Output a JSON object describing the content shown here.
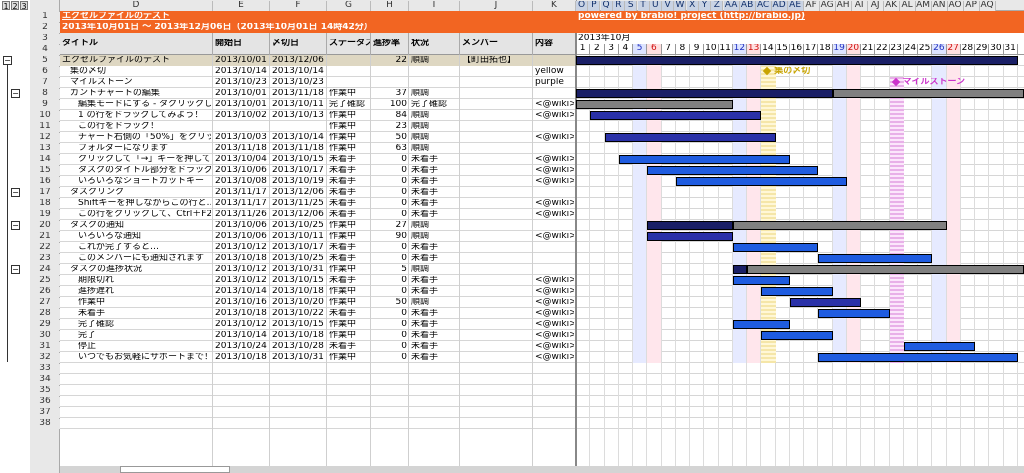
{
  "outline_levels": [
    "1",
    "2",
    "3"
  ],
  "columns": [
    "D",
    "E",
    "F",
    "G",
    "H",
    "I",
    "J",
    "K",
    "O",
    "P",
    "Q",
    "R",
    "S",
    "T",
    "U",
    "V",
    "W",
    "X",
    "Y",
    "Z",
    "AA",
    "AB",
    "AC",
    "AD",
    "AE",
    "AF",
    "AG",
    "AH",
    "AI",
    "AJ",
    "AK",
    "AL",
    "AM",
    "AN",
    "AO",
    "AP",
    "AQ"
  ],
  "header": {
    "title": "エクセルファイルのテスト",
    "date_range": "2013年10月01日 〜 2013年12月06日（2013年10月01日 14時42分）",
    "powered_by": "powered by brabio! project (http://brabio.jp)",
    "month": "2013年10月"
  },
  "table_headers": [
    "タイトル",
    "開始日",
    "〆切日",
    "ステータス",
    "進捗率",
    "状況",
    "メンバー",
    "内容"
  ],
  "days": [
    "1",
    "2",
    "3",
    "4",
    "5",
    "6",
    "7",
    "8",
    "9",
    "10",
    "11",
    "12",
    "13",
    "14",
    "15",
    "16",
    "17",
    "18",
    "19",
    "20",
    "21",
    "22",
    "23",
    "24",
    "25",
    "26",
    "27",
    "28",
    "29",
    "30",
    "31"
  ],
  "rows": [
    {
      "num": "5",
      "title": "エクセルファイルのテスト",
      "start": "2013/10/01",
      "end": "2013/12/06",
      "status": "",
      "pct": "22",
      "state": "順調",
      "member": "【町田拓也】",
      "content": ""
    },
    {
      "num": "6",
      "title": "集の〆切",
      "start": "2013/10/14",
      "end": "2013/10/14",
      "status": "",
      "pct": "",
      "state": "",
      "member": "",
      "content": "yellow"
    },
    {
      "num": "7",
      "title": "マイルストーン",
      "start": "2013/10/23",
      "end": "2013/10/23",
      "status": "",
      "pct": "",
      "state": "",
      "member": "",
      "content": "purple"
    },
    {
      "num": "8",
      "title": "ガントチャートの編集",
      "start": "2013/10/01",
      "end": "2013/11/18",
      "status": "作業中",
      "pct": "37",
      "state": "順調",
      "member": "",
      "content": ""
    },
    {
      "num": "9",
      "title": "編集モードにする - タクリックして",
      "start": "2013/10/01",
      "end": "2013/10/11",
      "status": "完了確認",
      "pct": "100",
      "state": "完了確認",
      "member": "",
      "content": "<@wiki>"
    },
    {
      "num": "10",
      "title": "1 の行をドラッグしてみよう！",
      "start": "2013/10/02",
      "end": "2013/10/13",
      "status": "作業中",
      "pct": "84",
      "state": "順調",
      "member": "",
      "content": "<@wiki>"
    },
    {
      "num": "11",
      "title": "この行をドラッグ！",
      "start": "",
      "end": "",
      "status": "作業中",
      "pct": "23",
      "state": "順調",
      "member": "",
      "content": ""
    },
    {
      "num": "12",
      "title": "チャート右側の「50%」をクリックし",
      "start": "2013/10/03",
      "end": "2013/10/14",
      "status": "作業中",
      "pct": "50",
      "state": "順調",
      "member": "",
      "content": "<@wiki>"
    },
    {
      "num": "13",
      "title": "フォルダーになります",
      "start": "2013/11/18",
      "end": "2013/11/18",
      "status": "作業中",
      "pct": "63",
      "state": "順調",
      "member": "",
      "content": ""
    },
    {
      "num": "14",
      "title": "クリックして「→」キーを押してみよ",
      "start": "2013/10/04",
      "end": "2013/10/15",
      "status": "未着手",
      "pct": "0",
      "state": "未着手",
      "member": "",
      "content": "<@wiki>"
    },
    {
      "num": "15",
      "title": "タスクのタイトル部分をドラッグす",
      "start": "2013/10/06",
      "end": "2013/10/17",
      "status": "未着手",
      "pct": "0",
      "state": "未着手",
      "member": "",
      "content": "<@wiki>"
    },
    {
      "num": "16",
      "title": "いろいろなショートカットキー",
      "start": "2013/10/08",
      "end": "2013/10/19",
      "status": "未着手",
      "pct": "0",
      "state": "未着手",
      "member": "",
      "content": "<@wiki>"
    },
    {
      "num": "17",
      "title": "タスクリンク",
      "start": "2013/11/17",
      "end": "2013/12/06",
      "status": "未着手",
      "pct": "0",
      "state": "未着手",
      "member": "",
      "content": ""
    },
    {
      "num": "18",
      "title": "Shiftキーを押しながらこの行と…",
      "start": "2013/11/17",
      "end": "2013/11/25",
      "status": "未着手",
      "pct": "0",
      "state": "未着手",
      "member": "",
      "content": "<@wiki>"
    },
    {
      "num": "19",
      "title": "この行をクリックして、Ctrl＋F2キ",
      "start": "2013/11/26",
      "end": "2013/12/06",
      "status": "未着手",
      "pct": "0",
      "state": "未着手",
      "member": "",
      "content": "<@wiki>"
    },
    {
      "num": "20",
      "title": "タスクの通知",
      "start": "2013/10/06",
      "end": "2013/10/25",
      "status": "作業中",
      "pct": "27",
      "state": "順調",
      "member": "",
      "content": ""
    },
    {
      "num": "21",
      "title": "いろいろな通知",
      "start": "2013/10/06",
      "end": "2013/10/11",
      "status": "作業中",
      "pct": "90",
      "state": "順調",
      "member": "",
      "content": "<@wiki>"
    },
    {
      "num": "22",
      "title": "これが完了すると…",
      "start": "2013/10/12",
      "end": "2013/10/17",
      "status": "未着手",
      "pct": "0",
      "state": "未着手",
      "member": "",
      "content": ""
    },
    {
      "num": "23",
      "title": "このメンバーにも通知されます",
      "start": "2013/10/18",
      "end": "2013/10/25",
      "status": "未着手",
      "pct": "0",
      "state": "未着手",
      "member": "",
      "content": ""
    },
    {
      "num": "24",
      "title": "タスクの進捗状況",
      "start": "2013/10/12",
      "end": "2013/10/31",
      "status": "作業中",
      "pct": "5",
      "state": "順調",
      "member": "",
      "content": ""
    },
    {
      "num": "25",
      "title": "期限切れ",
      "start": "2013/10/12",
      "end": "2013/10/15",
      "status": "未着手",
      "pct": "0",
      "state": "未着手",
      "member": "",
      "content": "<@wiki>"
    },
    {
      "num": "26",
      "title": "進捗遅れ",
      "start": "2013/10/14",
      "end": "2013/10/18",
      "status": "作業中",
      "pct": "0",
      "state": "未着手",
      "member": "",
      "content": "<@wiki>"
    },
    {
      "num": "27",
      "title": "作業中",
      "start": "2013/10/16",
      "end": "2013/10/20",
      "status": "作業中",
      "pct": "50",
      "state": "順調",
      "member": "",
      "content": "<@wiki>"
    },
    {
      "num": "28",
      "title": "未着手",
      "start": "2013/10/18",
      "end": "2013/10/22",
      "status": "未着手",
      "pct": "0",
      "state": "未着手",
      "member": "",
      "content": "<@wiki>"
    },
    {
      "num": "29",
      "title": "完了確認",
      "start": "2013/10/12",
      "end": "2013/10/15",
      "status": "作業中",
      "pct": "0",
      "state": "未着手",
      "member": "",
      "content": "<@wiki>"
    },
    {
      "num": "30",
      "title": "完了",
      "start": "2013/10/14",
      "end": "2013/10/18",
      "status": "作業中",
      "pct": "0",
      "state": "未着手",
      "member": "",
      "content": "<@wiki>"
    },
    {
      "num": "31",
      "title": "停止",
      "start": "2013/10/24",
      "end": "2013/10/28",
      "status": "未着手",
      "pct": "0",
      "state": "未着手",
      "member": "",
      "content": "<@wiki>"
    },
    {
      "num": "32",
      "title": "いつでもお気軽にサポートまで！",
      "start": "2013/10/18",
      "end": "2013/10/31",
      "status": "作業中",
      "pct": "0",
      "state": "未着手",
      "member": "",
      "content": "<@wiki>"
    },
    {
      "num": "33",
      "title": "",
      "start": "",
      "end": "",
      "status": "",
      "pct": "",
      "state": "",
      "member": "",
      "content": ""
    },
    {
      "num": "34",
      "title": "",
      "start": "",
      "end": "",
      "status": "",
      "pct": "",
      "state": "",
      "member": "",
      "content": ""
    },
    {
      "num": "35",
      "title": "",
      "start": "",
      "end": "",
      "status": "",
      "pct": "",
      "state": "",
      "member": "",
      "content": ""
    },
    {
      "num": "36",
      "title": "",
      "start": "",
      "end": "",
      "status": "",
      "pct": "",
      "state": "",
      "member": "",
      "content": ""
    },
    {
      "num": "37",
      "title": "",
      "start": "",
      "end": "",
      "status": "",
      "pct": "",
      "state": "",
      "member": "",
      "content": ""
    },
    {
      "num": "38",
      "title": "",
      "start": "",
      "end": "",
      "status": "",
      "pct": "",
      "state": "",
      "member": "",
      "content": ""
    }
  ],
  "milestones": [
    {
      "label": "集の〆切",
      "day": 14,
      "row": 6,
      "color": "#c8a400"
    },
    {
      "label": "マイルストーン",
      "day": 23,
      "row": 7,
      "color": "#cc33cc"
    }
  ],
  "bars": [
    {
      "row": 5,
      "start": 1,
      "end": 31,
      "color": "#1a1f66"
    },
    {
      "row": 8,
      "start": 1,
      "end": 18,
      "color": "#1a1f66",
      "rest": "#808080"
    },
    {
      "row": 9,
      "start": 1,
      "end": 11,
      "color": "#808080"
    },
    {
      "row": 10,
      "start": 2,
      "end": 13,
      "color": "#2a31a8"
    },
    {
      "row": 12,
      "start": 3,
      "end": 14,
      "color": "#2a31a8"
    },
    {
      "row": 14,
      "start": 4,
      "end": 15,
      "color": "#1f5ce0"
    },
    {
      "row": 15,
      "start": 6,
      "end": 17,
      "color": "#1f5ce0"
    },
    {
      "row": 16,
      "start": 8,
      "end": 19,
      "color": "#1f5ce0"
    },
    {
      "row": 20,
      "start": 6,
      "end": 25,
      "color": "#1a1f66",
      "rest": "#808080"
    },
    {
      "row": 21,
      "start": 6,
      "end": 11,
      "color": "#2a31a8"
    },
    {
      "row": 22,
      "start": 12,
      "end": 17,
      "color": "#1f5ce0"
    },
    {
      "row": 23,
      "start": 18,
      "end": 25,
      "color": "#1f5ce0"
    },
    {
      "row": 24,
      "start": 12,
      "end": 31,
      "color": "#1a1f66",
      "rest": "#808080"
    },
    {
      "row": 25,
      "start": 12,
      "end": 15,
      "color": "#1f5ce0"
    },
    {
      "row": 26,
      "start": 14,
      "end": 18,
      "color": "#1f5ce0"
    },
    {
      "row": 27,
      "start": 16,
      "end": 20,
      "color": "#2a31a8"
    },
    {
      "row": 28,
      "start": 18,
      "end": 22,
      "color": "#1f5ce0"
    },
    {
      "row": 29,
      "start": 12,
      "end": 15,
      "color": "#1f5ce0"
    },
    {
      "row": 30,
      "start": 14,
      "end": 18,
      "color": "#1f5ce0"
    },
    {
      "row": 31,
      "start": 24,
      "end": 28,
      "color": "#1f5ce0"
    },
    {
      "row": 32,
      "start": 18,
      "end": 31,
      "color": "#1f5ce0"
    }
  ],
  "colors": {
    "header_orange": "#f26522",
    "selected_header": "#c9d3e4",
    "grid": "#c8c8c8"
  }
}
